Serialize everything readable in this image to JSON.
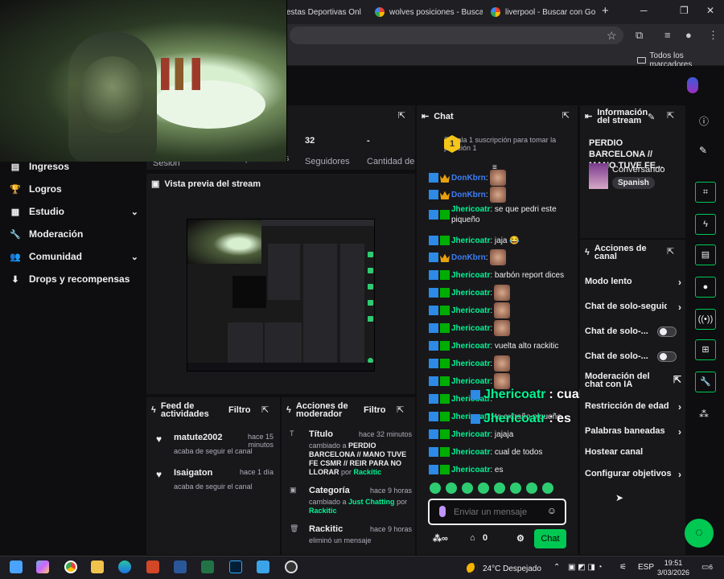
{
  "browser": {
    "tabs": [
      {
        "label": "estas Deportivas Onl"
      },
      {
        "label": "wolves posiciones - Busca"
      },
      {
        "label": "liverpool - Buscar con Go"
      }
    ],
    "bookmarks_label": "Todos los marcadores"
  },
  "leftnav": {
    "items": [
      {
        "label": "Ingresos",
        "icon": "income-icon"
      },
      {
        "label": "Logros",
        "icon": "trophy-icon"
      },
      {
        "label": "Estudio",
        "icon": "studio-icon"
      },
      {
        "label": "Moderación",
        "icon": "wrench-icon"
      },
      {
        "label": "Comunidad",
        "icon": "community-icon"
      },
      {
        "label": "Drops y recompensas",
        "icon": "drops-icon"
      }
    ]
  },
  "stats": {
    "followers_value": "32",
    "followers_label": "Seguidores",
    "subs_value": "-",
    "subs_label": "Cantidad de suscripciones",
    "session_label": "Sesión",
    "viewers_label": "Espectadores"
  },
  "preview": {
    "title": "Vista previa del stream"
  },
  "feed": {
    "title": "Feed de actividades",
    "filter": "Filtro",
    "items": [
      {
        "name": "matute2002",
        "time": "hace 15 minutos",
        "desc": "acaba de seguir el canal"
      },
      {
        "name": "Isaigaton",
        "time": "hace 1 día",
        "desc": "acaba de seguir el canal"
      }
    ]
  },
  "mod": {
    "title": "Acciones de moderador",
    "filter": "Filtro",
    "items": [
      {
        "title": "Título",
        "time": "hace 32 minutos",
        "pre": "cambiado a",
        "value": "PERDIO BARCELONA // MANO TUVE FE CSMR // REIR PARA NO LLORAR",
        "by": "por",
        "user": "Rackitic"
      },
      {
        "title": "Categoría",
        "time": "hace 9 horas",
        "pre": "cambiado a",
        "value": "Just Chatting",
        "by": "por",
        "user": "Rackitic"
      },
      {
        "title": "Rackitic",
        "time": "hace 9 horas",
        "desc": "eliminó un mensaje"
      }
    ]
  },
  "chat": {
    "title": "Chat",
    "sub_banner": "Regala 1 suscripción para tomar la posición 1",
    "sub_position": "1",
    "messages": [
      {
        "user": "DonKbrn",
        "text": "",
        "color": "blue",
        "emote": true
      },
      {
        "user": "DonKbrn",
        "text": "",
        "color": "blue",
        "emote": true
      },
      {
        "user": "Jhericoatr",
        "text": "se que pedri este piqueño",
        "color": "green",
        "emote": false
      },
      {
        "user": "Jhericoatr",
        "text": "jaja 😂",
        "color": "green",
        "emote": false
      },
      {
        "user": "DonKbrn",
        "text": "",
        "color": "blue",
        "emote": true
      },
      {
        "user": "Jhericoatr",
        "text": "barbón report dices",
        "color": "green",
        "emote": false
      },
      {
        "user": "Jhericoatr",
        "text": "",
        "color": "green",
        "emote": true
      },
      {
        "user": "Jhericoatr",
        "text": "",
        "color": "green",
        "emote": true
      },
      {
        "user": "Jhericoatr",
        "text": "",
        "color": "green",
        "emote": true
      },
      {
        "user": "Jhericoatr",
        "text": "vuelta alto rackitic",
        "color": "green",
        "emote": false
      },
      {
        "user": "Jhericoatr",
        "text": "",
        "color": "green",
        "emote": true
      },
      {
        "user": "Jhericoatr",
        "text": "",
        "color": "green",
        "emote": true
      },
      {
        "user": "Jhericoatr",
        "text": "",
        "color": "green",
        "emote": false
      },
      {
        "user": "Jhericoatr",
        "text": "te extraño piqueño",
        "color": "green",
        "emote": false
      },
      {
        "user": "Jhericoatr",
        "text": "jajaja",
        "color": "green",
        "emote": false
      },
      {
        "user": "Jhericoatr",
        "text": "cual de todos",
        "color": "green",
        "emote": false
      },
      {
        "user": "Jhericoatr",
        "text": "es",
        "color": "green",
        "emote": false
      }
    ],
    "input_placeholder": "Enviar un mensaje",
    "points": "0",
    "send_label": "Chat"
  },
  "captions": [
    {
      "user": "Jhericoatr",
      "text": ": cual de todos"
    },
    {
      "user": "Jhericoatr",
      "text": ": es"
    }
  ],
  "info": {
    "title": "Información del stream",
    "stream_title": "PERDIO BARCELONA // MANO TUVE FE...",
    "category": "Conversando",
    "tag": "Spanish"
  },
  "actions": {
    "title": "Acciones de canal",
    "items": [
      {
        "label": "Modo lento",
        "kind": "chevron"
      },
      {
        "label": "Chat de solo-seguido",
        "kind": "chevron"
      },
      {
        "label": "Chat de solo-...",
        "kind": "toggle"
      },
      {
        "label": "Chat de solo-...",
        "kind": "toggle"
      },
      {
        "label": "Moderación del chat con IA",
        "kind": "popout"
      },
      {
        "label": "Restricción de edad",
        "kind": "chevron"
      },
      {
        "label": "Palabras baneadas",
        "kind": "chevron"
      },
      {
        "label": "Hostear canal",
        "kind": "none"
      },
      {
        "label": "Configurar objetivos",
        "kind": "chevron"
      }
    ]
  },
  "taskbar": {
    "weather": "24°C Despejado",
    "lang": "ESP",
    "time": "19:51",
    "date": "3/03/2026",
    "notifications": "6"
  },
  "colors": {
    "accent": "#00c853",
    "username_green": "#00f593",
    "username_blue": "#3d7ef7"
  }
}
